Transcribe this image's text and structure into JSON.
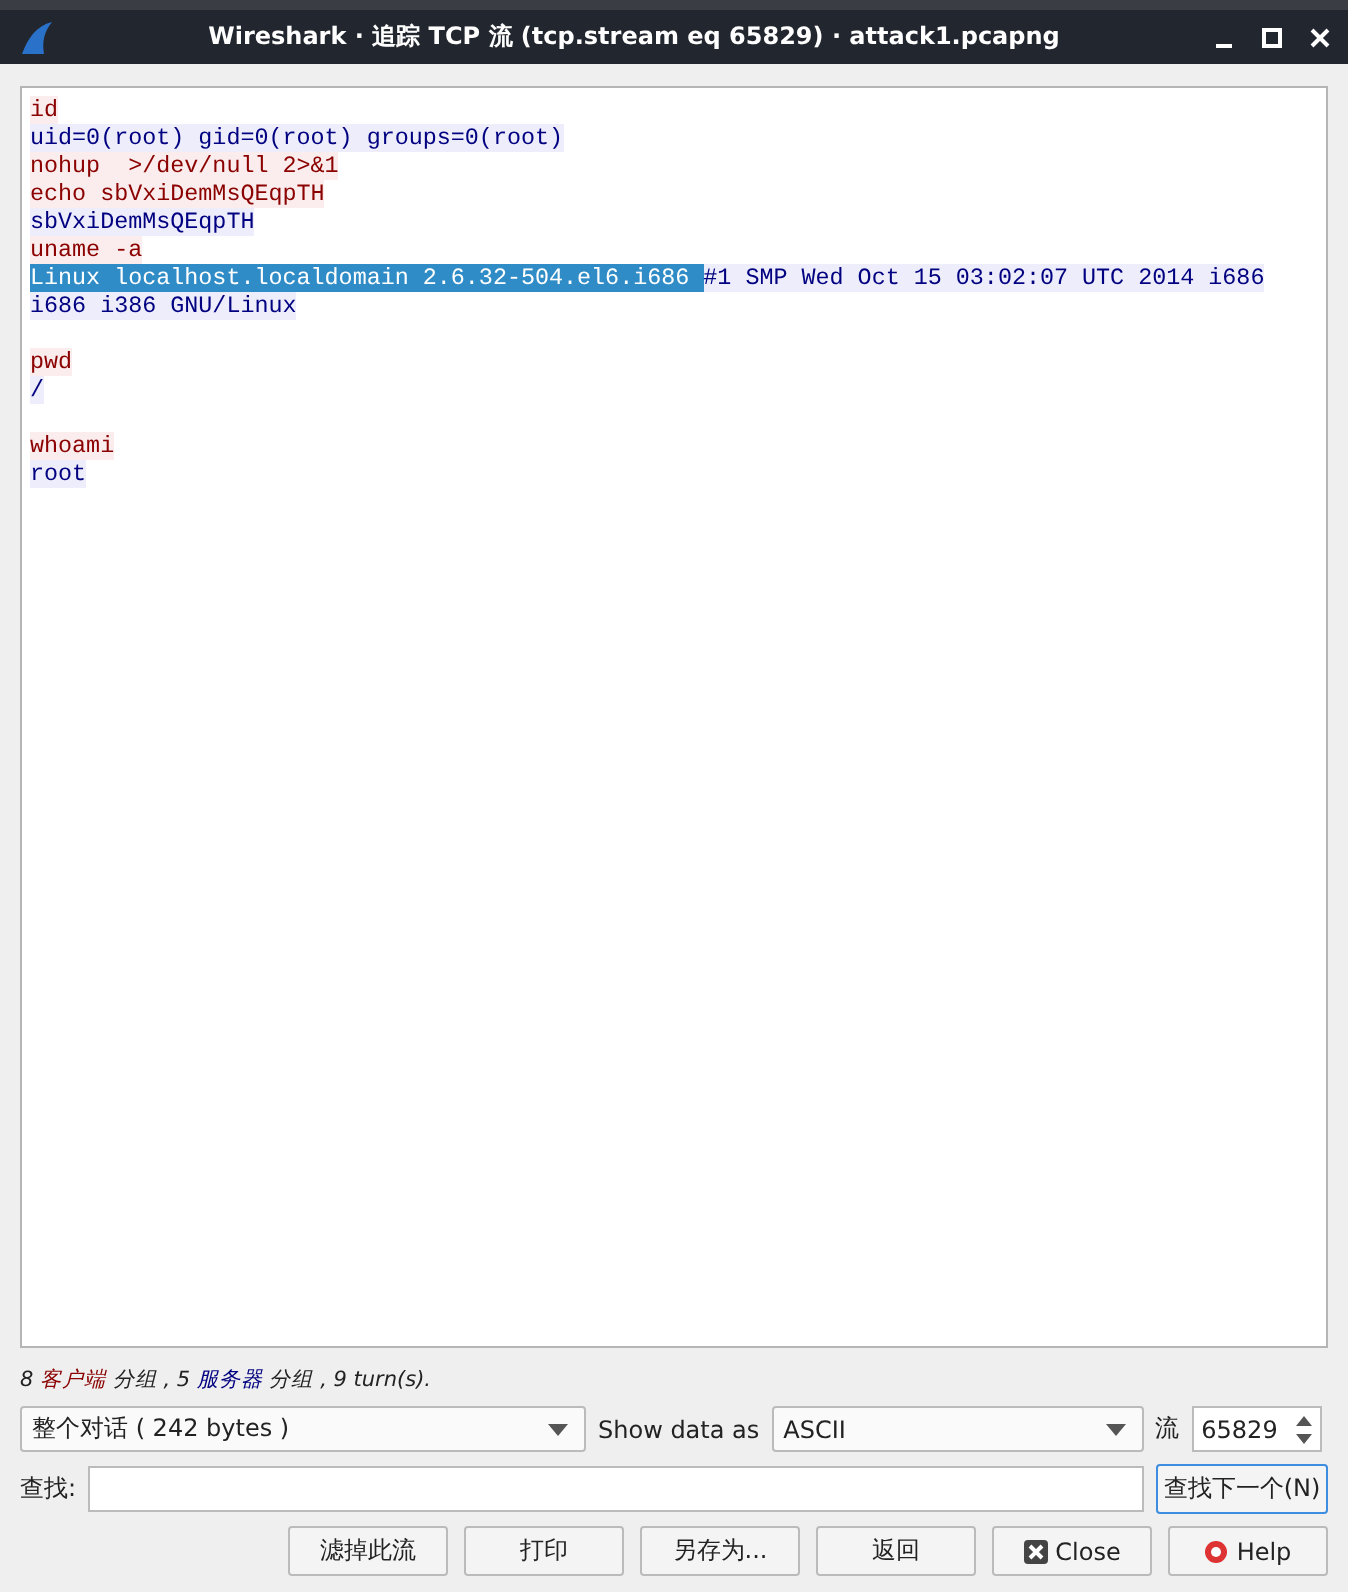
{
  "window": {
    "title": "Wireshark · 追踪 TCP 流 (tcp.stream eq 65829) · attack1.pcapng"
  },
  "stream": [
    {
      "kind": "client",
      "segments": [
        {
          "text": "id",
          "selected": false
        }
      ]
    },
    {
      "kind": "server",
      "segments": [
        {
          "text": "uid=0(root) gid=0(root) groups=0(root)",
          "selected": false
        }
      ]
    },
    {
      "kind": "client",
      "segments": [
        {
          "text": "nohup  >/dev/null 2>&1",
          "selected": false
        }
      ]
    },
    {
      "kind": "client",
      "segments": [
        {
          "text": "echo sbVxiDemMsQEqpTH",
          "selected": false
        }
      ]
    },
    {
      "kind": "server",
      "segments": [
        {
          "text": "sbVxiDemMsQEqpTH",
          "selected": false
        }
      ]
    },
    {
      "kind": "client",
      "segments": [
        {
          "text": "uname -a",
          "selected": false
        }
      ]
    },
    {
      "kind": "server",
      "segments": [
        {
          "text": "Linux localhost.localdomain 2.6.32-504.el6.i686 ",
          "selected": true
        },
        {
          "text": "#1 SMP Wed Oct 15 03:02:07 UTC 2014 i686",
          "selected": false
        }
      ]
    },
    {
      "kind": "server",
      "segments": [
        {
          "text": "i686 i386 GNU/Linux",
          "selected": false
        }
      ]
    },
    {
      "kind": "blank"
    },
    {
      "kind": "client",
      "segments": [
        {
          "text": "pwd",
          "selected": false
        }
      ]
    },
    {
      "kind": "server",
      "segments": [
        {
          "text": "/",
          "selected": false
        }
      ]
    },
    {
      "kind": "blank"
    },
    {
      "kind": "client",
      "segments": [
        {
          "text": "whoami",
          "selected": false
        }
      ]
    },
    {
      "kind": "server",
      "segments": [
        {
          "text": "root",
          "selected": false
        }
      ]
    }
  ],
  "summary": [
    {
      "kind": "plain",
      "text": "8 "
    },
    {
      "kind": "client",
      "text": "客户端"
    },
    {
      "kind": "plain",
      "text": " 分组 , 5 "
    },
    {
      "kind": "server",
      "text": "服务器"
    },
    {
      "kind": "plain",
      "text": " 分组 , 9 turn(s)."
    }
  ],
  "conversation_select": {
    "value": "整个对话 ( 242 bytes )"
  },
  "show_data_label": "Show data as",
  "format_select": {
    "value": "ASCII"
  },
  "stream_label": "流",
  "stream_spin": {
    "value": "65829"
  },
  "find_label": "查找:",
  "find_next_button": "查找下一个(N)",
  "buttons": [
    {
      "kind": "plain",
      "label": "滤掉此流"
    },
    {
      "kind": "plain",
      "label": "打印"
    },
    {
      "kind": "plain",
      "label": "另存为..."
    },
    {
      "kind": "plain",
      "label": "返回"
    },
    {
      "kind": "close",
      "label": "Close"
    },
    {
      "kind": "help",
      "label": "Help"
    }
  ]
}
